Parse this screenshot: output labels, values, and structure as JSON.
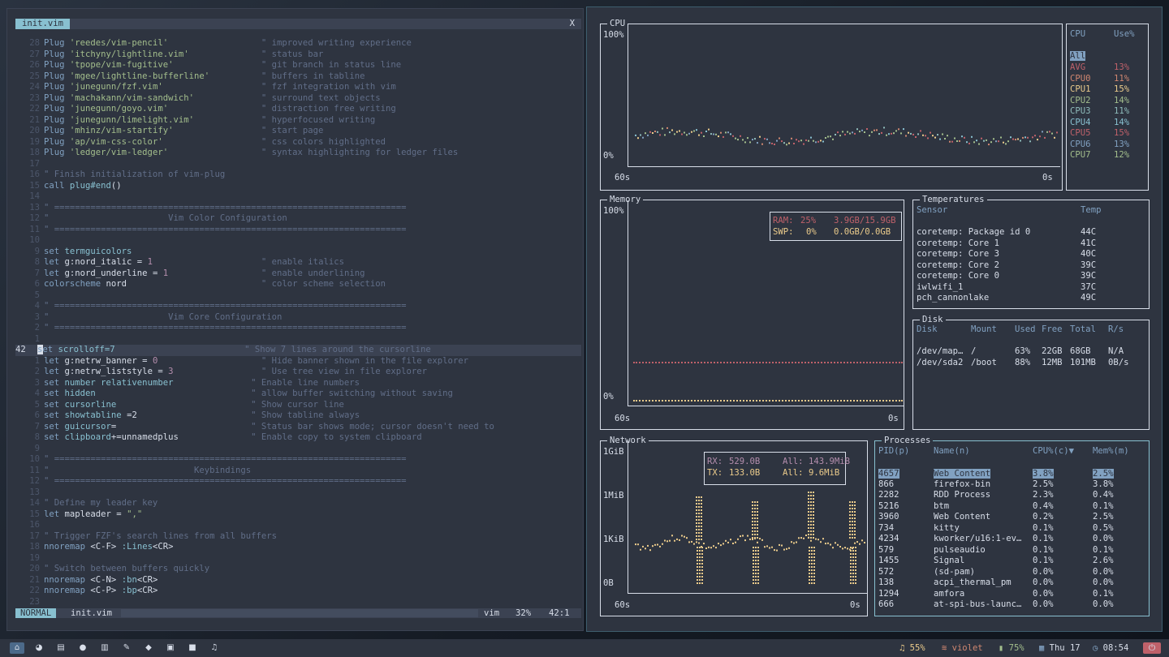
{
  "editor": {
    "tab": "init.vim",
    "close": "X",
    "lines": [
      {
        "n": "28",
        "t": [
          [
            "Plug ",
            "kw"
          ],
          [
            "'reedes/vim-pencil'",
            "str"
          ],
          [
            "                  ",
            ""
          ],
          [
            "\" improved writing experience",
            "cm"
          ]
        ]
      },
      {
        "n": "27",
        "t": [
          [
            "Plug ",
            "kw"
          ],
          [
            "'itchyny/lightline.vim'",
            "str"
          ],
          [
            "              ",
            ""
          ],
          [
            "\" status bar",
            "cm"
          ]
        ]
      },
      {
        "n": "26",
        "t": [
          [
            "Plug ",
            "kw"
          ],
          [
            "'tpope/vim-fugitive'",
            "str"
          ],
          [
            "                 ",
            ""
          ],
          [
            "\" git branch in status line",
            "cm"
          ]
        ]
      },
      {
        "n": "25",
        "t": [
          [
            "Plug ",
            "kw"
          ],
          [
            "'mgee/lightline-bufferline'",
            "str"
          ],
          [
            "          ",
            ""
          ],
          [
            "\" buffers in tabline",
            "cm"
          ]
        ]
      },
      {
        "n": "24",
        "t": [
          [
            "Plug ",
            "kw"
          ],
          [
            "'junegunn/fzf.vim'",
            "str"
          ],
          [
            "                   ",
            ""
          ],
          [
            "\" fzf integration with vim",
            "cm"
          ]
        ]
      },
      {
        "n": "23",
        "t": [
          [
            "Plug ",
            "kw"
          ],
          [
            "'machakann/vim-sandwich'",
            "str"
          ],
          [
            "             ",
            ""
          ],
          [
            "\" surround text objects",
            "cm"
          ]
        ]
      },
      {
        "n": "22",
        "t": [
          [
            "Plug ",
            "kw"
          ],
          [
            "'junegunn/goyo.vim'",
            "str"
          ],
          [
            "                  ",
            ""
          ],
          [
            "\" distraction free writing",
            "cm"
          ]
        ]
      },
      {
        "n": "21",
        "t": [
          [
            "Plug ",
            "kw"
          ],
          [
            "'junegunn/limelight.vim'",
            "str"
          ],
          [
            "             ",
            ""
          ],
          [
            "\" hyperfocused writing",
            "cm"
          ]
        ]
      },
      {
        "n": "20",
        "t": [
          [
            "Plug ",
            "kw"
          ],
          [
            "'mhinz/vim-startify'",
            "str"
          ],
          [
            "                 ",
            ""
          ],
          [
            "\" start page",
            "cm"
          ]
        ]
      },
      {
        "n": "19",
        "t": [
          [
            "Plug ",
            "kw"
          ],
          [
            "'ap/vim-css-color'",
            "str"
          ],
          [
            "                   ",
            ""
          ],
          [
            "\" css colors highlighted",
            "cm"
          ]
        ]
      },
      {
        "n": "18",
        "t": [
          [
            "Plug ",
            "kw"
          ],
          [
            "'ledger/vim-ledger'",
            "str"
          ],
          [
            "                  ",
            ""
          ],
          [
            "\" syntax highlighting for ledger files",
            "cm"
          ]
        ]
      },
      {
        "n": "17",
        "t": []
      },
      {
        "n": "16",
        "t": [
          [
            "\" Finish initialization of vim-plug",
            "cm"
          ]
        ]
      },
      {
        "n": "15",
        "t": [
          [
            "call ",
            "kw"
          ],
          [
            "plug#end",
            "fn"
          ],
          [
            "()",
            ""
          ]
        ]
      },
      {
        "n": "14",
        "t": []
      },
      {
        "n": "13",
        "t": [
          [
            "\" ====================================================================",
            "cm"
          ]
        ]
      },
      {
        "n": "12",
        "t": [
          [
            "\"                       Vim Color Configuration",
            "cm"
          ]
        ]
      },
      {
        "n": "11",
        "t": [
          [
            "\" ====================================================================",
            "cm"
          ]
        ]
      },
      {
        "n": "10",
        "t": []
      },
      {
        "n": "9",
        "t": [
          [
            "set ",
            "kw"
          ],
          [
            "termguicolors",
            "fn"
          ]
        ]
      },
      {
        "n": "8",
        "t": [
          [
            "let ",
            "kw"
          ],
          [
            "g:nord_italic = ",
            ""
          ],
          [
            "1",
            "num"
          ],
          [
            "                     ",
            ""
          ],
          [
            "\" enable italics",
            "cm"
          ]
        ]
      },
      {
        "n": "7",
        "t": [
          [
            "let ",
            "kw"
          ],
          [
            "g:nord_underline = ",
            ""
          ],
          [
            "1",
            "num"
          ],
          [
            "                  ",
            ""
          ],
          [
            "\" enable underlining",
            "cm"
          ]
        ]
      },
      {
        "n": "6",
        "t": [
          [
            "colorscheme ",
            "kw"
          ],
          [
            "nord",
            ""
          ],
          [
            "                          ",
            ""
          ],
          [
            "\" color scheme selection",
            "cm"
          ]
        ]
      },
      {
        "n": "5",
        "t": []
      },
      {
        "n": "4",
        "t": [
          [
            "\" ====================================================================",
            "cm"
          ]
        ]
      },
      {
        "n": "3",
        "t": [
          [
            "\"                       Vim Core Configuration",
            "cm"
          ]
        ]
      },
      {
        "n": "2",
        "t": [
          [
            "\" ====================================================================",
            "cm"
          ]
        ]
      },
      {
        "n": "1",
        "t": []
      },
      {
        "n": "42",
        "cur": true,
        "t": [
          [
            "set ",
            "cursor"
          ],
          [
            "scrolloff=7",
            "fn"
          ],
          [
            "                         ",
            ""
          ],
          [
            "\" Show 7 lines around the cursorline",
            "cm"
          ]
        ]
      },
      {
        "n": "1",
        "t": [
          [
            "let ",
            "kw"
          ],
          [
            "g:netrw_banner = ",
            ""
          ],
          [
            "0",
            "num"
          ],
          [
            "                    ",
            ""
          ],
          [
            "\" Hide banner shown in the file explorer",
            "cm"
          ]
        ]
      },
      {
        "n": "2",
        "t": [
          [
            "let ",
            "kw"
          ],
          [
            "g:netrw_liststyle = ",
            ""
          ],
          [
            "3",
            "num"
          ],
          [
            "                 ",
            ""
          ],
          [
            "\" Use tree view in file explorer",
            "cm"
          ]
        ]
      },
      {
        "n": "3",
        "t": [
          [
            "set ",
            "kw"
          ],
          [
            "number relativenumber",
            "fn"
          ],
          [
            "               ",
            ""
          ],
          [
            "\" Enable line numbers",
            "cm"
          ]
        ]
      },
      {
        "n": "4",
        "t": [
          [
            "set ",
            "kw"
          ],
          [
            "hidden",
            "fn"
          ],
          [
            "                              ",
            ""
          ],
          [
            "\" allow buffer switching without saving",
            "cm"
          ]
        ]
      },
      {
        "n": "5",
        "t": [
          [
            "set ",
            "kw"
          ],
          [
            "cursorline",
            "fn"
          ],
          [
            "                          ",
            ""
          ],
          [
            "\" Show cursor line",
            "cm"
          ]
        ]
      },
      {
        "n": "6",
        "t": [
          [
            "set ",
            "kw"
          ],
          [
            "showtabline",
            "fn"
          ],
          [
            " =2",
            ""
          ],
          [
            "                      ",
            ""
          ],
          [
            "\" Show tabline always",
            "cm"
          ]
        ]
      },
      {
        "n": "7",
        "t": [
          [
            "set ",
            "kw"
          ],
          [
            "guicursor",
            "fn"
          ],
          [
            "=",
            ""
          ],
          [
            "                          ",
            ""
          ],
          [
            "\" Status bar shows mode; cursor doesn't need to",
            "cm"
          ]
        ]
      },
      {
        "n": "8",
        "t": [
          [
            "set ",
            "kw"
          ],
          [
            "clipboard",
            "fn"
          ],
          [
            "+=unnamedplus",
            ""
          ],
          [
            "              ",
            ""
          ],
          [
            "\" Enable copy to system clipboard",
            "cm"
          ]
        ]
      },
      {
        "n": "9",
        "t": []
      },
      {
        "n": "10",
        "t": [
          [
            "\" ====================================================================",
            "cm"
          ]
        ]
      },
      {
        "n": "11",
        "t": [
          [
            "\"                            Keybindings",
            "cm"
          ]
        ]
      },
      {
        "n": "12",
        "t": [
          [
            "\" ====================================================================",
            "cm"
          ]
        ]
      },
      {
        "n": "13",
        "t": []
      },
      {
        "n": "14",
        "t": [
          [
            "\" Define my leader key",
            "cm"
          ]
        ]
      },
      {
        "n": "15",
        "t": [
          [
            "let ",
            "kw"
          ],
          [
            "mapleader = ",
            ""
          ],
          [
            "\",\"",
            "str"
          ]
        ]
      },
      {
        "n": "16",
        "t": []
      },
      {
        "n": "17",
        "t": [
          [
            "\" Trigger FZF's search lines from all buffers",
            "cm"
          ]
        ]
      },
      {
        "n": "18",
        "t": [
          [
            "nnoremap ",
            "kw"
          ],
          [
            "<C-F> ",
            ""
          ],
          [
            ":Lines",
            "fn"
          ],
          [
            "<CR>",
            ""
          ]
        ]
      },
      {
        "n": "19",
        "t": []
      },
      {
        "n": "20",
        "t": [
          [
            "\" Switch between buffers quickly",
            "cm"
          ]
        ]
      },
      {
        "n": "21",
        "t": [
          [
            "nnoremap ",
            "kw"
          ],
          [
            "<C-N> ",
            ""
          ],
          [
            ":bn",
            "fn"
          ],
          [
            "<CR>",
            ""
          ]
        ]
      },
      {
        "n": "22",
        "t": [
          [
            "nnoremap ",
            "kw"
          ],
          [
            "<C-P> ",
            ""
          ],
          [
            ":bp",
            "fn"
          ],
          [
            "<CR>",
            ""
          ]
        ]
      },
      {
        "n": "23",
        "t": []
      }
    ],
    "status": {
      "mode": "NORMAL",
      "file": "init.vim",
      "filetype": "vim",
      "percent": "32%",
      "position": "42:1"
    }
  },
  "btm": {
    "cpu": {
      "title": "CPU",
      "ymax": "100%",
      "ymin": "0%",
      "xleft": "60s",
      "xright": "0s",
      "col1": "CPU",
      "col2": "Use%",
      "all": "All",
      "rows": [
        {
          "name": "AVG",
          "use": "13%",
          "color": "#bf616a"
        },
        {
          "name": "CPU0",
          "use": "11%",
          "color": "#d08770"
        },
        {
          "name": "CPU1",
          "use": "15%",
          "color": "#ebcb8b"
        },
        {
          "name": "CPU2",
          "use": "14%",
          "color": "#a3be8c"
        },
        {
          "name": "CPU3",
          "use": "11%",
          "color": "#8fbcbb"
        },
        {
          "name": "CPU4",
          "use": "14%",
          "color": "#88c0d0"
        },
        {
          "name": "CPU5",
          "use": "15%",
          "color": "#bf616a"
        },
        {
          "name": "CPU6",
          "use": "13%",
          "color": "#81a1c1"
        },
        {
          "name": "CPU7",
          "use": "12%",
          "color": "#a3be8c"
        }
      ]
    },
    "memory": {
      "title": "Memory",
      "ymax": "100%",
      "ymin": "0%",
      "xleft": "60s",
      "xright": "0s",
      "ram_label": "RAM:",
      "ram_pct": "25%",
      "ram_val": "3.9GB/15.9GB",
      "swp_label": "SWP:",
      "swp_pct": "0%",
      "swp_val": "0.0GB/0.0GB",
      "ram_level": 0.25,
      "swp_level": 0.0
    },
    "temps": {
      "title": "Temperatures",
      "h1": "Sensor",
      "h2": "Temp",
      "rows": [
        [
          "coretemp: Package id 0",
          "44C"
        ],
        [
          "coretemp: Core 1",
          "41C"
        ],
        [
          "coretemp: Core 3",
          "40C"
        ],
        [
          "coretemp: Core 2",
          "39C"
        ],
        [
          "coretemp: Core 0",
          "39C"
        ],
        [
          "iwlwifi_1",
          "37C"
        ],
        [
          "pch_cannonlake",
          "49C"
        ]
      ]
    },
    "disk": {
      "title": "Disk",
      "headers": [
        "Disk",
        "Mount",
        "Used",
        "Free",
        "Total",
        "R/s"
      ],
      "rows": [
        [
          "/dev/map…",
          "/",
          "63%",
          "22GB",
          "68GB",
          "N/A"
        ],
        [
          "/dev/sda2",
          "/boot",
          "88%",
          "12MB",
          "101MB",
          "0B/s"
        ]
      ]
    },
    "network": {
      "title": "Network",
      "y1": "1GiB",
      "y2": "1MiB",
      "y3": "1KiB",
      "y4": "0B",
      "xleft": "60s",
      "xright": "0s",
      "rx_label": "RX:",
      "rx_val": "529.0B",
      "rx_all_label": "All:",
      "rx_all": "143.9MiB",
      "tx_label": "TX:",
      "tx_val": "133.0B",
      "tx_all_label": "All:",
      "tx_all": "9.6MiB"
    },
    "processes": {
      "title": "Processes",
      "headers": [
        "PID(p)",
        "Name(n)",
        "CPU%(c)▼",
        "Mem%(m)"
      ],
      "rows": [
        [
          "4657",
          "Web Content",
          "3.8%",
          "2.5%"
        ],
        [
          "866",
          "firefox-bin",
          "2.5%",
          "3.8%"
        ],
        [
          "2282",
          "RDD Process",
          "2.3%",
          "0.4%"
        ],
        [
          "5216",
          "btm",
          "0.4%",
          "0.1%"
        ],
        [
          "3960",
          "Web Content",
          "0.2%",
          "2.5%"
        ],
        [
          "734",
          "kitty",
          "0.1%",
          "0.5%"
        ],
        [
          "4234",
          "kworker/u16:1-ev…",
          "0.1%",
          "0.0%"
        ],
        [
          "579",
          "pulseaudio",
          "0.1%",
          "0.1%"
        ],
        [
          "1455",
          "Signal",
          "0.1%",
          "2.6%"
        ],
        [
          "572",
          "(sd-pam)",
          "0.0%",
          "0.0%"
        ],
        [
          "138",
          "acpi_thermal_pm",
          "0.0%",
          "0.0%"
        ],
        [
          "1294",
          "amfora",
          "0.0%",
          "0.1%"
        ],
        [
          "666",
          "at-spi-bus-launc…",
          "0.0%",
          "0.0%"
        ]
      ]
    }
  },
  "taskbar": {
    "icons": [
      "home-icon",
      "browser-icon",
      "files-icon",
      "chat-icon",
      "reader-icon",
      "notes-icon",
      "git-icon",
      "windows-icon",
      "video-icon",
      "music-icon"
    ],
    "volume": "55%",
    "wifi": "violet",
    "battery": "75%",
    "date": "Thu 17",
    "time": "08:54",
    "colors": {
      "accent": "#88c0d0",
      "red": "#bf616a",
      "yellow": "#ebcb8b"
    }
  }
}
